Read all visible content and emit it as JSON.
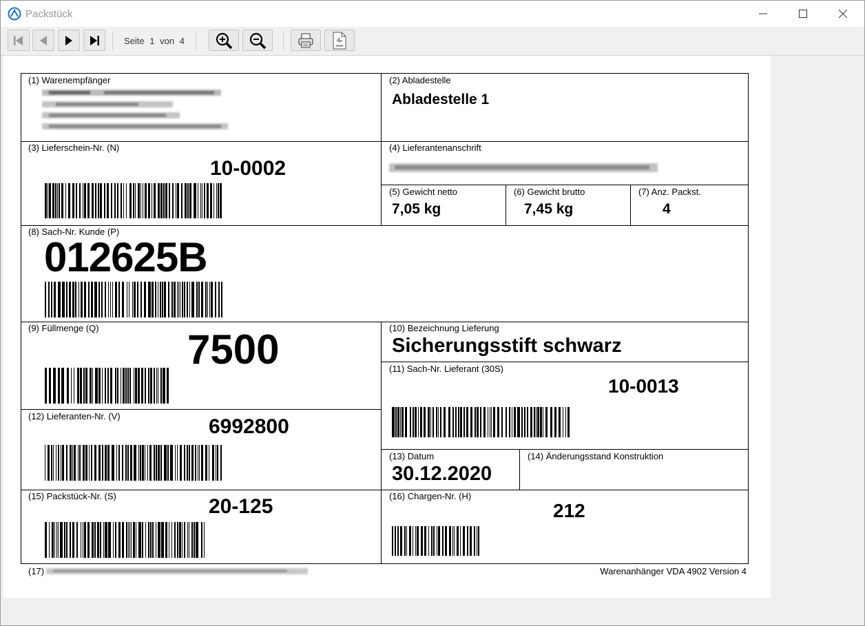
{
  "window": {
    "title": "Packstück",
    "controls": {
      "minimize": "minimize-icon",
      "maximize": "maximize-icon",
      "close": "close-icon"
    }
  },
  "toolbar": {
    "page_word": "Seite",
    "page_current": "1",
    "page_of": "von",
    "page_total": "4",
    "buttons": [
      "first-page-icon",
      "previous-page-icon",
      "next-page-icon",
      "last-page-icon",
      "zoom-in-icon",
      "zoom-out-icon",
      "print-icon",
      "pdf-export-icon"
    ]
  },
  "label": {
    "f1": {
      "label": "(1) Warenempfänger"
    },
    "f2": {
      "label": "(2) Abladestelle",
      "value": "Abladestelle 1"
    },
    "f3": {
      "label": "(3) Lieferschein-Nr. (N)",
      "value": "10-0002"
    },
    "f4": {
      "label": "(4) Lieferantenanschrift"
    },
    "f5": {
      "label": "(5) Gewicht netto",
      "value": "7,05 kg"
    },
    "f6": {
      "label": "(6) Gewicht brutto",
      "value": "7,45 kg"
    },
    "f7": {
      "label": "(7) Anz. Packst.",
      "value": "4"
    },
    "f8": {
      "label": "(8) Sach-Nr. Kunde (P)",
      "value": "012625B"
    },
    "f9": {
      "label": "(9) Füllmenge (Q)",
      "value": "7500"
    },
    "f10": {
      "label": "(10) Bezeichnung Lieferung",
      "value": "Sicherungsstift schwarz"
    },
    "f11": {
      "label": "(11) Sach-Nr. Lieferant (30S)",
      "value": "10-0013"
    },
    "f12": {
      "label": "(12) Lieferanten-Nr. (V)",
      "value": "6992800"
    },
    "f13": {
      "label": "(13) Datum",
      "value": "30.12.2020"
    },
    "f14": {
      "label": "(14) Änderungsstand Konstruktion"
    },
    "f15": {
      "label": "(15) Packstück-Nr. (S)",
      "value": "20-125"
    },
    "f16": {
      "label": "(16) Chargen-Nr. (H)",
      "value": "212"
    },
    "f17": {
      "label": "(17)"
    },
    "footer_right": "Warenanhänger VDA 4902 Version 4"
  },
  "colors": {
    "accent": "#1e6fb8",
    "text": "#000000",
    "disabled": "#9a9a9a"
  }
}
